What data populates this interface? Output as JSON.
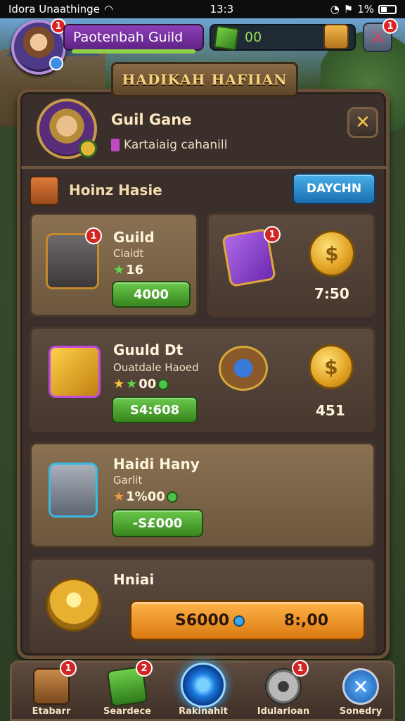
{
  "status_bar": {
    "carrier": "Idora Unaathinge",
    "time": "13:3",
    "battery": "1%"
  },
  "hud": {
    "guild_name": "Paotenbah Guild",
    "gems": "00",
    "avatar_badge": "1",
    "sword_badge": "1"
  },
  "panel": {
    "title": "HADIKAH HAFIIAN",
    "profile": {
      "name": "Guil Gane",
      "subtitle": "Kartaiaig cahanill"
    },
    "close_label": "✕",
    "section": {
      "title": "Hoinz Hasie",
      "button": "DAYCHN"
    }
  },
  "items": [
    {
      "title": "Guild",
      "sub": "Ciaidt",
      "stars": "16",
      "price": "4000",
      "badge": "1"
    },
    {
      "coin_value": "7:50",
      "badge": "1"
    },
    {
      "title": "Guuld Dt",
      "sub": "Ouatdale Haoed",
      "stars": "00",
      "price": "S4:608",
      "coin_value": "451"
    },
    {
      "title": "Haidi Hany",
      "sub": "Garlit",
      "stars": "1%00",
      "price": "-S£000"
    },
    {
      "title": "Hniai",
      "left_value": "S6000",
      "right_value": "8:,00"
    }
  ],
  "bottom_nav": [
    {
      "label": "Etabarr",
      "badge": "1"
    },
    {
      "label": "Seardece",
      "badge": "2"
    },
    {
      "label": "Rakinahit",
      "badge": ""
    },
    {
      "label": "Idularioan",
      "badge": "1"
    },
    {
      "label": "Sonedry",
      "badge": ""
    }
  ],
  "colors": {
    "accent_gold": "#f6d27a",
    "panel_bg": "#3a2f2b",
    "price_green": "#6ac94a",
    "action_blue": "#1a6fb0"
  }
}
